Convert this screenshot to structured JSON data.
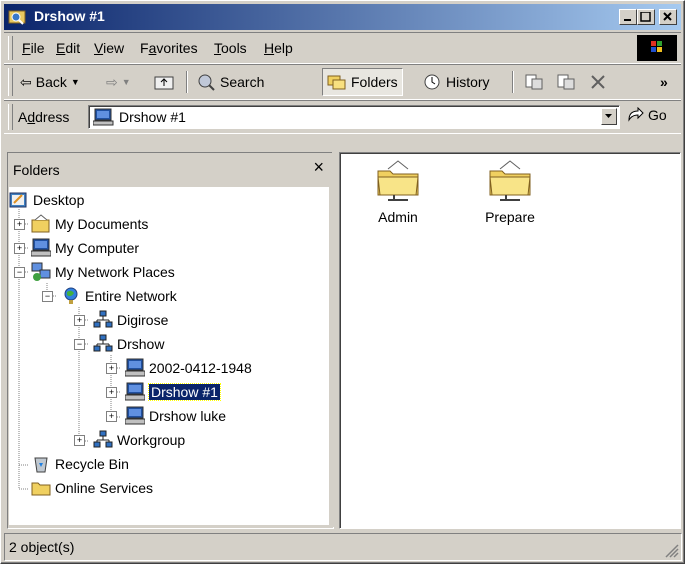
{
  "window": {
    "title": "Drshow #1"
  },
  "menubar": {
    "items": [
      "File",
      "Edit",
      "View",
      "Favorites",
      "Tools",
      "Help"
    ],
    "underline": [
      "F",
      "E",
      "V",
      "a",
      "T",
      "H"
    ]
  },
  "toolbar": {
    "back": "Back",
    "search": "Search",
    "folders": "Folders",
    "history": "History"
  },
  "address": {
    "label_pre": "A",
    "label_u": "d",
    "label_post": "dress",
    "value": "Drshow #1",
    "go": "Go"
  },
  "folders_pane": {
    "title": "Folders",
    "close": "×"
  },
  "tree": [
    {
      "label": "Desktop"
    },
    {
      "label": "My Documents"
    },
    {
      "label": "My Computer"
    },
    {
      "label": "My Network Places"
    },
    {
      "label": "Entire Network"
    },
    {
      "label": "Digirose"
    },
    {
      "label": "Drshow"
    },
    {
      "label": "2002-0412-1948"
    },
    {
      "label": "Drshow #1"
    },
    {
      "label": "Drshow luke"
    },
    {
      "label": "Workgroup"
    },
    {
      "label": "Recycle Bin"
    },
    {
      "label": "Online Services"
    }
  ],
  "content": {
    "items": [
      {
        "label": "Admin"
      },
      {
        "label": "Prepare"
      }
    ]
  },
  "status": {
    "text": "2 object(s)"
  }
}
